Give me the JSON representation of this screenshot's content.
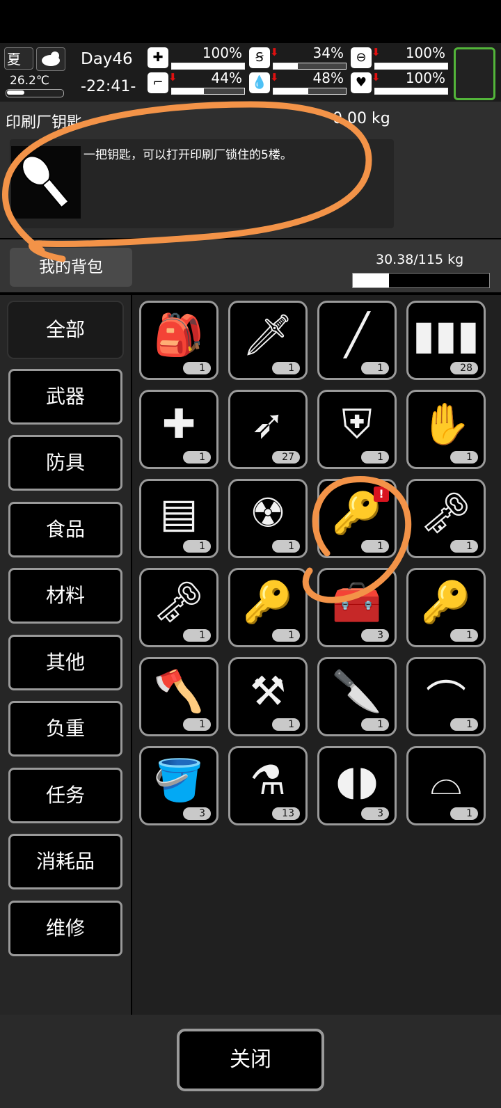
{
  "status": {
    "season": "夏",
    "temperature": "26.2℃",
    "day": "Day46",
    "time": "-22:41-",
    "stats": [
      {
        "icon": "medkit-icon",
        "value": "100%",
        "drop": false,
        "level": 1.0
      },
      {
        "icon": "stomach-icon",
        "value": "34%",
        "drop": true,
        "level": 0.34
      },
      {
        "icon": "bladder-icon",
        "value": "100%",
        "drop": true,
        "level": 1.0
      },
      {
        "icon": "boot-icon",
        "value": "44%",
        "drop": true,
        "level": 0.44
      },
      {
        "icon": "water-drop-icon",
        "value": "48%",
        "drop": true,
        "level": 0.48
      },
      {
        "icon": "heart-icon",
        "value": "100%",
        "drop": true,
        "level": 1.0
      }
    ],
    "accent_green": "#53b53a"
  },
  "item_detail": {
    "name": "印刷厂钥匙",
    "weight": "0.00 kg",
    "description": "一把钥匙，可以打开印刷厂锁住的5楼。",
    "icon": "key-icon"
  },
  "bag": {
    "tab_label": "我的背包",
    "capacity": "30.38/115 kg",
    "capacity_fraction": 0.264
  },
  "categories": [
    "全部",
    "武器",
    "防具",
    "食品",
    "材料",
    "其他",
    "负重",
    "任务",
    "消耗品",
    "维修"
  ],
  "items": [
    {
      "icon": "backpack-icon",
      "glyph": "🎒",
      "count": "1"
    },
    {
      "icon": "spear-icon",
      "glyph": "🗡",
      "count": "1"
    },
    {
      "icon": "rifle-icon",
      "glyph": "╱",
      "count": "1"
    },
    {
      "icon": "bullets-icon",
      "glyph": "▮▮▮",
      "count": "28"
    },
    {
      "icon": "crossbow-icon",
      "glyph": "✚",
      "count": "1"
    },
    {
      "icon": "arrow-icon",
      "glyph": "➶",
      "count": "27"
    },
    {
      "icon": "shield-icon",
      "glyph": "⛨",
      "count": "1"
    },
    {
      "icon": "gloves-icon",
      "glyph": "✋",
      "count": "1"
    },
    {
      "icon": "vest-icon",
      "glyph": "▤",
      "count": "1"
    },
    {
      "icon": "gas-mask-icon",
      "glyph": "☢",
      "count": "1"
    },
    {
      "icon": "key-icon",
      "glyph": "🔑",
      "count": "1",
      "alert": "!"
    },
    {
      "icon": "key-icon",
      "glyph": "🗝",
      "count": "1"
    },
    {
      "icon": "key-icon",
      "glyph": "🗝",
      "count": "1"
    },
    {
      "icon": "key-icon",
      "glyph": "🔑",
      "count": "1"
    },
    {
      "icon": "toolbox-icon",
      "glyph": "🧰",
      "count": "3"
    },
    {
      "icon": "car-key-icon",
      "glyph": "🔑",
      "count": "1"
    },
    {
      "icon": "axe-icon",
      "glyph": "🪓",
      "count": "1"
    },
    {
      "icon": "shovel-icon",
      "glyph": "⚒",
      "count": "1"
    },
    {
      "icon": "machete-icon",
      "glyph": "🔪",
      "count": "1"
    },
    {
      "icon": "crowbar-icon",
      "glyph": "⌒",
      "count": "1"
    },
    {
      "icon": "bucket-icon",
      "glyph": "🪣",
      "count": "3"
    },
    {
      "icon": "beaker-icon",
      "glyph": "⚗",
      "count": "13"
    },
    {
      "icon": "soap-icon",
      "glyph": "◖◗",
      "count": "3"
    },
    {
      "icon": "cap-icon",
      "glyph": "⌓",
      "count": "1"
    }
  ],
  "close_label": "关闭",
  "annotation_color": "#f39348"
}
